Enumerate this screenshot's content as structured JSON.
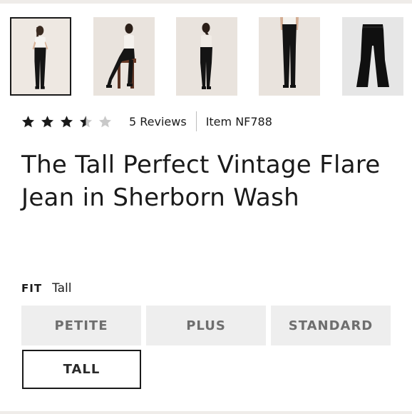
{
  "gallery": {
    "thumbnails": [
      {
        "name": "thumbnail-front-view",
        "selected": true
      },
      {
        "name": "thumbnail-seated-view",
        "selected": false
      },
      {
        "name": "thumbnail-back-view",
        "selected": false
      },
      {
        "name": "thumbnail-detail-view",
        "selected": false
      },
      {
        "name": "thumbnail-flat-lay",
        "selected": false
      }
    ]
  },
  "rating": {
    "value": 3.5,
    "max": 5,
    "star_color": "#1a1a1a",
    "empty_star_color": "#c9c9c9",
    "reviews_text": "5 Reviews"
  },
  "product": {
    "item_number": "Item NF788",
    "title": "The Tall Perfect Vintage Flare Jean in Sherborn Wash"
  },
  "fit": {
    "label": "FIT",
    "selected_value": "Tall",
    "options": [
      {
        "label": "PETITE",
        "selected": false
      },
      {
        "label": "PLUS",
        "selected": false
      },
      {
        "label": "STANDARD",
        "selected": false
      },
      {
        "label": "TALL",
        "selected": true
      }
    ]
  }
}
